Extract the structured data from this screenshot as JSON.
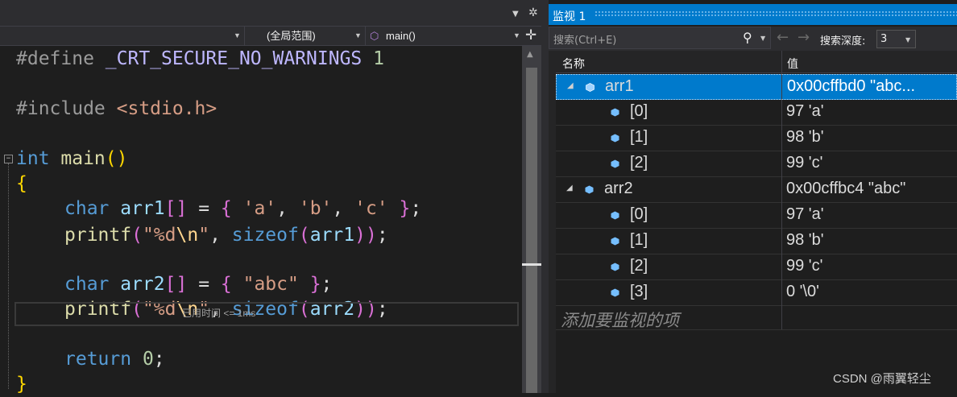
{
  "editor": {
    "nav_scope": "(全局范围)",
    "nav_function": "main()",
    "elapsed_hint": "已用时间 <= 1ms"
  },
  "code_lines": {
    "l1_a": "#define",
    "l1_b": " _CRT_SECURE_NO_WARNINGS ",
    "l1_c": "1",
    "l2_a": "#include",
    "l2_b": " <stdio.h>",
    "l3_a": "int",
    "l3_b": " main",
    "l3_c": "()",
    "l4": "{",
    "l5_kw": "char",
    "l5_var": " arr1",
    "l5_br": "[]",
    "l5_eq": " = ",
    "l5_ob": "{",
    "l5_s1": " 'a'",
    "l5_c1": ",",
    "l5_s2": " 'b'",
    "l5_c2": ",",
    "l5_s3": " 'c'",
    "l5_cb": " }",
    "l5_end": ";",
    "l6_fn": "printf",
    "l6_op": "(",
    "l6_s1": "\"%d",
    "l6_esc": "\\n",
    "l6_s2": "\"",
    "l6_comma": ", ",
    "l6_kw": "sizeof",
    "l6_op2": "(",
    "l6_var": "arr1",
    "l6_cp": "))",
    "l6_end": ";",
    "l7_kw": "char",
    "l7_var": " arr2",
    "l7_br": "[]",
    "l7_eq": " = ",
    "l7_ob": "{",
    "l7_s": " \"abc\"",
    "l7_cb": " }",
    "l7_end": ";",
    "l8_fn": "printf",
    "l8_op": "(",
    "l8_s1": "\"%d",
    "l8_esc": "\\n",
    "l8_s2": "\"",
    "l8_comma": ", ",
    "l8_kw": "sizeof",
    "l8_op2": "(",
    "l8_var": "arr2",
    "l8_cp": "))",
    "l8_end": ";",
    "l9_kw": "return",
    "l9_num": " 0",
    "l9_end": ";",
    "l10": "}"
  },
  "watch": {
    "title": "监视 1",
    "search_placeholder": "搜索(Ctrl+E)",
    "depth_label": "搜索深度:",
    "depth_value": "3",
    "col_name": "名称",
    "col_value": "值",
    "rows": [
      {
        "name": "arr1",
        "value": "0x00cffbd0 \"abc..."
      },
      {
        "name": "[0]",
        "value": "97 'a'"
      },
      {
        "name": "[1]",
        "value": "98 'b'"
      },
      {
        "name": "[2]",
        "value": "99 'c'"
      },
      {
        "name": "arr2",
        "value": "0x00cffbc4 \"abc\""
      },
      {
        "name": "[0]",
        "value": "97 'a'"
      },
      {
        "name": "[1]",
        "value": "98 'b'"
      },
      {
        "name": "[2]",
        "value": "99 'c'"
      },
      {
        "name": "[3]",
        "value": "0 '\\0'"
      }
    ],
    "add_item": "添加要监视的项"
  },
  "watermark": "CSDN @雨翼轻尘",
  "colors": {
    "accent": "#007acc",
    "editor_bg": "#1e1e1e",
    "keyword": "#569cd6",
    "string": "#d69d85"
  }
}
